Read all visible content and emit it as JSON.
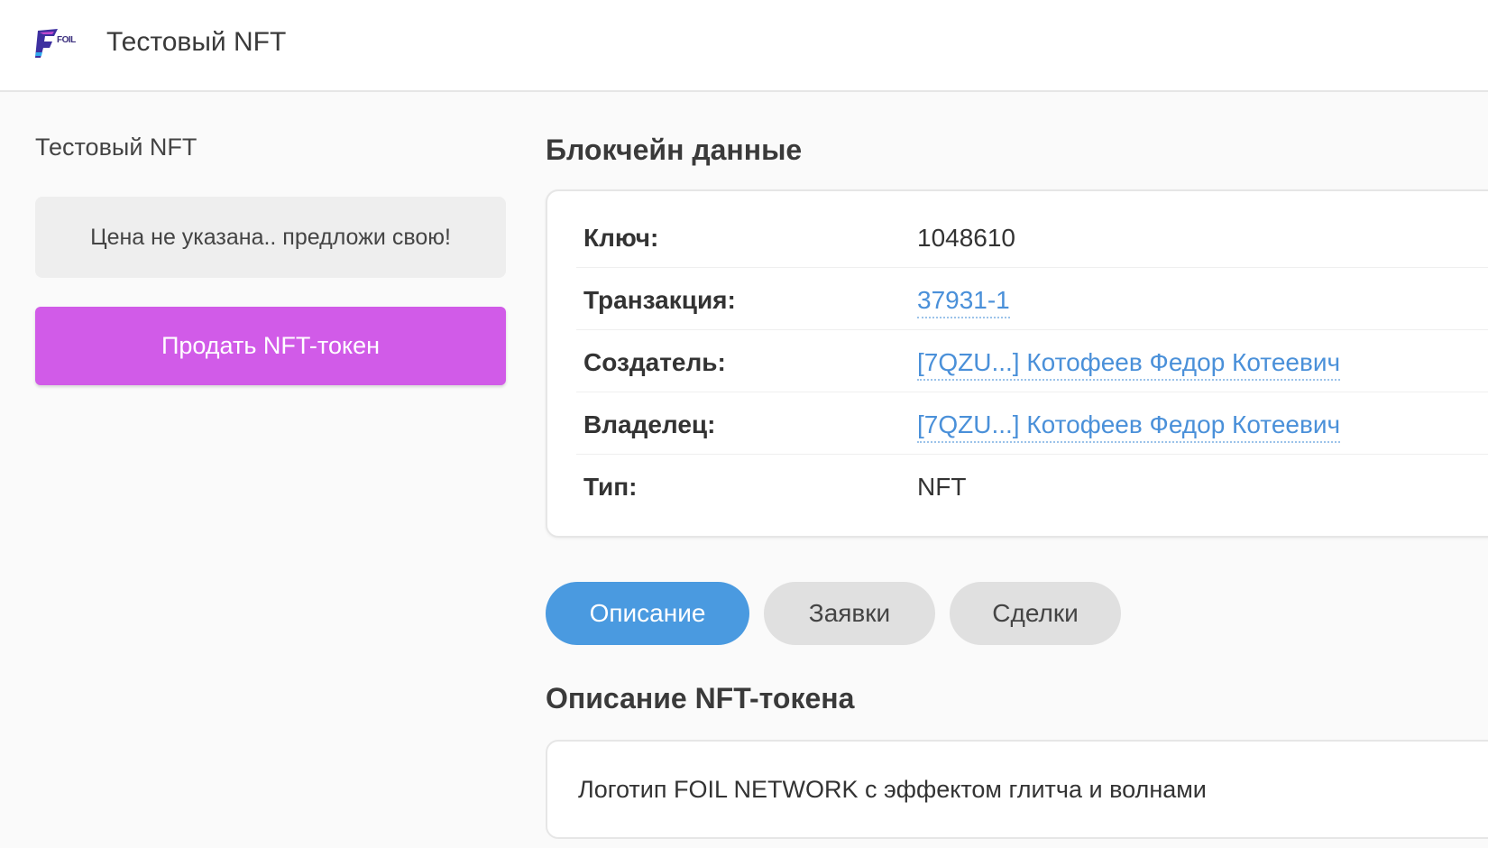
{
  "header": {
    "logo_text": "FOIL",
    "title": "Тестовый NFT"
  },
  "left": {
    "nft_name": "Тестовый NFT",
    "price_text": "Цена не указана.. предложи свою!",
    "sell_button_label": "Продать NFT-токен"
  },
  "blockchain": {
    "section_title": "Блокчейн данные",
    "rows": [
      {
        "label": "Ключ:",
        "value": "1048610"
      },
      {
        "label": "Транзакция:",
        "value": "37931-1"
      },
      {
        "label": "Создатель:",
        "value": "[7QZU...] Котофеев Федор Котеевич"
      },
      {
        "label": "Владелец:",
        "value": "[7QZU...] Котофеев Федор Котеевич"
      },
      {
        "label": "Тип:",
        "value": "NFT"
      }
    ]
  },
  "tabs": [
    {
      "label": "Описание",
      "active": true
    },
    {
      "label": "Заявки",
      "active": false
    },
    {
      "label": "Сделки",
      "active": false
    }
  ],
  "description": {
    "section_title": "Описание NFT-токена",
    "text": "Логотип FOIL NETWORK с эффектом глитча и волнами"
  },
  "colors": {
    "sell_button": "#d15be8",
    "active_tab": "#4a9ae0",
    "link": "#4a90d9"
  }
}
